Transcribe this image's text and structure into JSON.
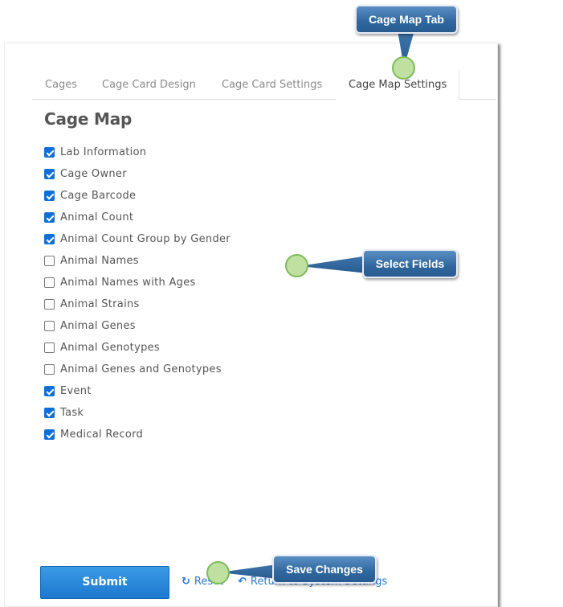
{
  "tabs": [
    {
      "label": "Cages",
      "active": false
    },
    {
      "label": "Cage Card Design",
      "active": false
    },
    {
      "label": "Cage Card Settings",
      "active": false
    },
    {
      "label": "Cage Map Settings",
      "active": true
    }
  ],
  "section_title": "Cage Map",
  "fields": [
    {
      "label": "Lab Information",
      "checked": true
    },
    {
      "label": "Cage Owner",
      "checked": true
    },
    {
      "label": "Cage Barcode",
      "checked": true
    },
    {
      "label": "Animal Count",
      "checked": true
    },
    {
      "label": "Animal Count Group by Gender",
      "checked": true
    },
    {
      "label": "Animal Names",
      "checked": false
    },
    {
      "label": "Animal Names with Ages",
      "checked": false
    },
    {
      "label": "Animal Strains",
      "checked": false
    },
    {
      "label": "Animal Genes",
      "checked": false
    },
    {
      "label": "Animal Genotypes",
      "checked": false
    },
    {
      "label": "Animal Genes and Genotypes",
      "checked": false
    },
    {
      "label": "Event",
      "checked": true
    },
    {
      "label": "Task",
      "checked": true
    },
    {
      "label": "Medical Record",
      "checked": true
    }
  ],
  "actions": {
    "submit_label": "Submit",
    "reset_label": "Reset",
    "reset_icon": "refresh-icon",
    "return_label": "Return to System Settings",
    "return_icon": "reply-arrow-icon"
  },
  "callouts": {
    "tab": "Cage Map Tab",
    "fields": "Select Fields",
    "save": "Save Changes"
  },
  "colors": {
    "accent": "#1d78cf",
    "checkbox": "#0f6fd6",
    "link": "#2a7ad6",
    "callout": "#2f679e",
    "marker": "#bfe0a0"
  }
}
